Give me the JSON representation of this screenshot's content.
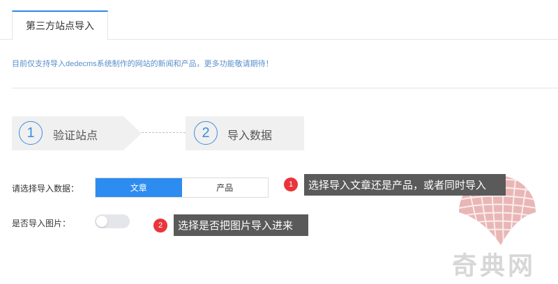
{
  "tabs": [
    {
      "label": "第三方站点导入",
      "active": true
    }
  ],
  "notice": "目前仅支持导入dedecms系统制作的网站的新闻和产品，更多功能敬请期待！",
  "steps": [
    {
      "number": "1",
      "label": "验证站点"
    },
    {
      "number": "2",
      "label": "导入数据"
    }
  ],
  "form": {
    "data_type_label": "请选择导入数据：",
    "data_type_options": [
      "文章",
      "产品"
    ],
    "data_type_selected": "文章",
    "import_images_label": "是否导入图片：",
    "import_images_enabled": false
  },
  "annotations": [
    {
      "number": "1",
      "text": "选择导入文章还是产品，或者同时导入"
    },
    {
      "number": "2",
      "text": "选择是否把图片导入进来"
    }
  ],
  "watermark": {
    "text": "奇典网"
  },
  "colors": {
    "accent": "#2d8cf0",
    "badge": "#e8353b",
    "tooltip": "#5a5a5a"
  }
}
